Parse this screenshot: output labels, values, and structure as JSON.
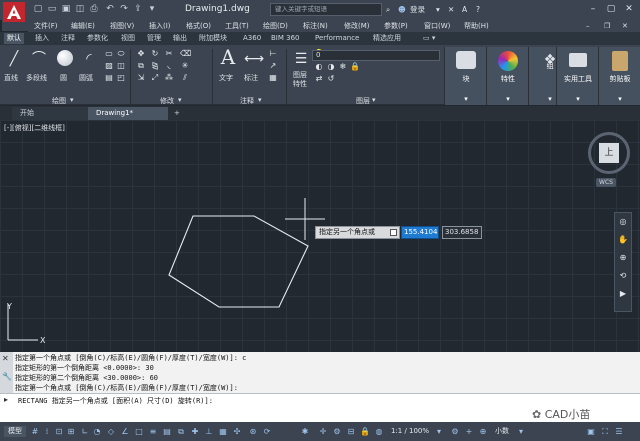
{
  "title": {
    "document": "Drawing1.dwg",
    "search_placeholder": "键入关键字或短语",
    "login": "登录",
    "quick_access": [
      "new-icon",
      "open-icon",
      "save-icon",
      "saveas-icon",
      "print-icon",
      "undo-icon",
      "redo-icon"
    ]
  },
  "menu": [
    "文件(F)",
    "编辑(E)",
    "视图(V)",
    "插入(I)",
    "格式(O)",
    "工具(T)",
    "绘图(D)",
    "标注(N)",
    "修改(M)",
    "参数(P)",
    "窗口(W)",
    "帮助(H)"
  ],
  "ribbon_tabs": [
    "默认",
    "插入",
    "注释",
    "参数化",
    "视图",
    "管理",
    "输出",
    "附加模块",
    "A360",
    "BIM 360",
    "Performance",
    "精选应用"
  ],
  "ribbon": {
    "draw": {
      "title": "绘图",
      "line": "直线",
      "polyline": "多段线",
      "circle": "圆",
      "arc": "圆弧"
    },
    "modify": {
      "title": "修改"
    },
    "annotation": {
      "title": "注释",
      "text": "文字",
      "dimension": "标注"
    },
    "layers": {
      "title": "图层",
      "layer_props": "图层\n特性",
      "current_layer": "0"
    },
    "block": "块",
    "properties": "特性",
    "groups": "组",
    "utilities": "实用工具",
    "clipboard": "剪贴板"
  },
  "file_tabs": [
    "开始",
    "Drawing1*"
  ],
  "viewport_label": "[-][俯视][二维线框]",
  "viewcube": {
    "face": "上",
    "wcs": "WCS"
  },
  "tooltip": {
    "prompt": "指定另一个角点或",
    "x": "155.4104",
    "y": "303.6858"
  },
  "ucs": {
    "x": "X",
    "y": "Y"
  },
  "history": [
    "指定第一个角点或 [倒角(C)/标高(E)/圆角(F)/厚度(T)/宽度(W)]: c",
    "指定矩形的第一个倒角距离 <0.0000>: 30",
    "指定矩形的第二个倒角距离 <30.0000>: 60",
    "指定第一个角点或 [倒角(C)/标高(E)/圆角(F)/厚度(T)/宽度(W)]:"
  ],
  "command_line": "RECTANG 指定另一个角点或 [面积(A) 尺寸(D) 旋转(R)]:",
  "status": {
    "model": "模型",
    "scale": "1:1 / 100%",
    "units": "小数"
  },
  "watermark": "CAD小苗",
  "colors": {
    "accent": "#1f7ad1",
    "canvas": "#212830",
    "panel": "#3b4450"
  }
}
